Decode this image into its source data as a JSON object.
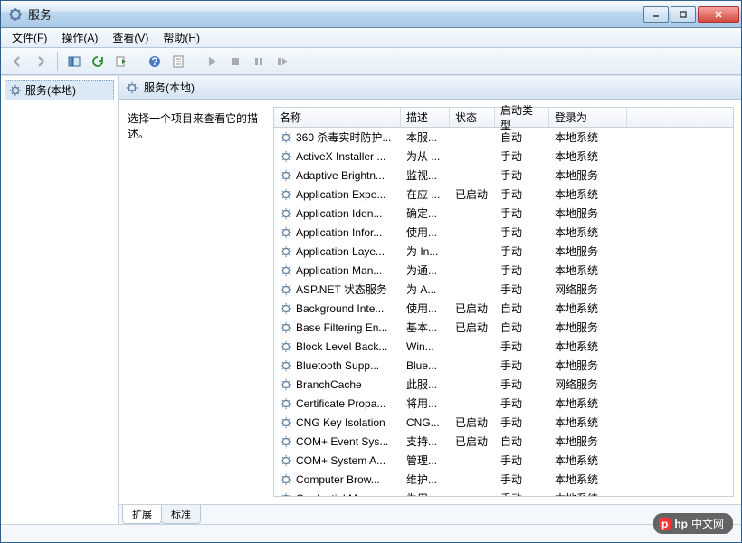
{
  "window": {
    "title": "服务"
  },
  "menu": {
    "file": "文件(F)",
    "action": "操作(A)",
    "view": "查看(V)",
    "help": "帮助(H)"
  },
  "tree": {
    "root": "服务(本地)"
  },
  "pane": {
    "title": "服务(本地)",
    "prompt": "选择一个项目来查看它的描述。"
  },
  "columns": {
    "name": "名称",
    "desc": "描述",
    "status": "状态",
    "startup": "启动类型",
    "logon": "登录为"
  },
  "tabs": {
    "extended": "扩展",
    "standard": "标准"
  },
  "watermark": {
    "p": "p",
    "hp": "hp",
    "suffix": "中文网"
  },
  "services": [
    {
      "name": "360 杀毒实时防护...",
      "desc": "本服...",
      "status": "",
      "startup": "自动",
      "logon": "本地系统"
    },
    {
      "name": "ActiveX Installer ...",
      "desc": "为从 ...",
      "status": "",
      "startup": "手动",
      "logon": "本地系统"
    },
    {
      "name": "Adaptive Brightn...",
      "desc": "监视...",
      "status": "",
      "startup": "手动",
      "logon": "本地服务"
    },
    {
      "name": "Application Expe...",
      "desc": "在应 ...",
      "status": "已启动",
      "startup": "手动",
      "logon": "本地系统"
    },
    {
      "name": "Application Iden...",
      "desc": "确定...",
      "status": "",
      "startup": "手动",
      "logon": "本地服务"
    },
    {
      "name": "Application Infor...",
      "desc": "使用...",
      "status": "",
      "startup": "手动",
      "logon": "本地系统"
    },
    {
      "name": "Application Laye...",
      "desc": "为 In...",
      "status": "",
      "startup": "手动",
      "logon": "本地服务"
    },
    {
      "name": "Application Man...",
      "desc": "为通...",
      "status": "",
      "startup": "手动",
      "logon": "本地系统"
    },
    {
      "name": "ASP.NET 状态服务",
      "desc": "为 A...",
      "status": "",
      "startup": "手动",
      "logon": "网络服务"
    },
    {
      "name": "Background Inte...",
      "desc": "使用...",
      "status": "已启动",
      "startup": "自动",
      "logon": "本地系统"
    },
    {
      "name": "Base Filtering En...",
      "desc": "基本...",
      "status": "已启动",
      "startup": "自动",
      "logon": "本地服务"
    },
    {
      "name": "Block Level Back...",
      "desc": "Win...",
      "status": "",
      "startup": "手动",
      "logon": "本地系统"
    },
    {
      "name": "Bluetooth Supp...",
      "desc": "Blue...",
      "status": "",
      "startup": "手动",
      "logon": "本地服务"
    },
    {
      "name": "BranchCache",
      "desc": "此服...",
      "status": "",
      "startup": "手动",
      "logon": "网络服务"
    },
    {
      "name": "Certificate Propa...",
      "desc": "将用...",
      "status": "",
      "startup": "手动",
      "logon": "本地系统"
    },
    {
      "name": "CNG Key Isolation",
      "desc": "CNG...",
      "status": "已启动",
      "startup": "手动",
      "logon": "本地系统"
    },
    {
      "name": "COM+ Event Sys...",
      "desc": "支持...",
      "status": "已启动",
      "startup": "自动",
      "logon": "本地服务"
    },
    {
      "name": "COM+ System A...",
      "desc": "管理...",
      "status": "",
      "startup": "手动",
      "logon": "本地系统"
    },
    {
      "name": "Computer Brow...",
      "desc": "维护...",
      "status": "",
      "startup": "手动",
      "logon": "本地系统"
    },
    {
      "name": "Credential Mana...",
      "desc": "为用...",
      "status": "",
      "startup": "手动",
      "logon": "本地系统"
    }
  ]
}
